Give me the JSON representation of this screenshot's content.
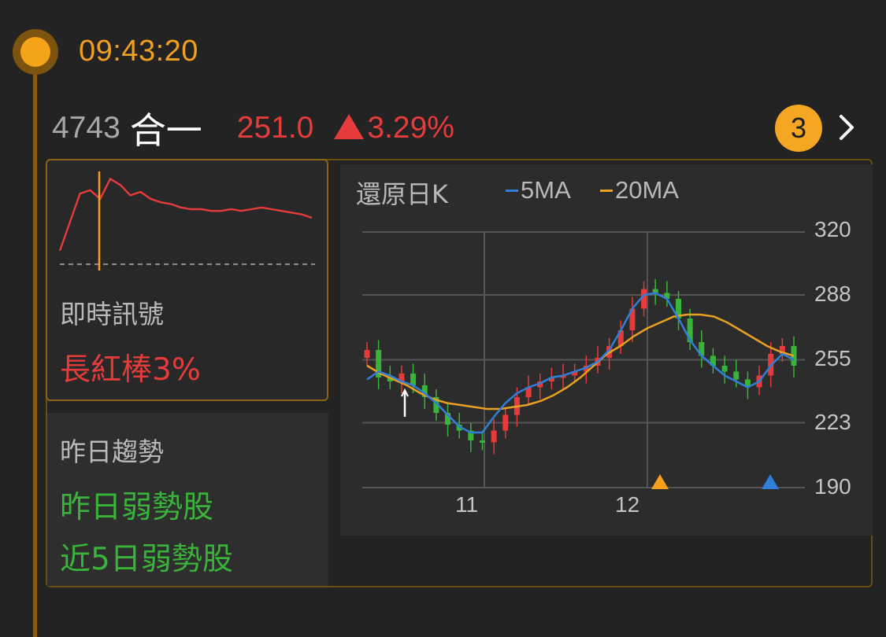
{
  "timestamp": "09:43:20",
  "stock": {
    "code": "4743",
    "name": "合一",
    "price": "251.0",
    "change": "3.29%",
    "change_direction": "up",
    "colors": {
      "up": "#e63b3b",
      "down": "#3ab33a",
      "accent": "#f5a623"
    }
  },
  "badge_count": "3",
  "signal": {
    "label": "即時訊號",
    "value": "長紅棒3%"
  },
  "trend": {
    "label": "昨日趨勢",
    "items": [
      "昨日弱勢股",
      "近5日弱勢股"
    ]
  },
  "kchart": {
    "title": "還原日K",
    "legend": [
      {
        "name": "5MA",
        "color": "#2f7fd8"
      },
      {
        "name": "20MA",
        "color": "#e8a020"
      }
    ],
    "y_ticks": [
      "320",
      "288",
      "255",
      "223",
      "190"
    ],
    "x_ticks": [
      "11",
      "12"
    ]
  },
  "chart_data": [
    {
      "type": "line",
      "title": "",
      "description_of_series": "intraday price",
      "series": [
        {
          "values": [
            0.12,
            0.45,
            0.78,
            0.82,
            0.72,
            0.95,
            0.88,
            0.76,
            0.8,
            0.72,
            0.68,
            0.66,
            0.62,
            0.6,
            0.6,
            0.58,
            0.58,
            0.6,
            0.58,
            0.6,
            0.62,
            0.6,
            0.58,
            0.56,
            0.54,
            0.5
          ]
        }
      ],
      "baseline": "dashed previous close",
      "marker_index": 5
    },
    {
      "type": "candlestick",
      "title": "還原日K",
      "y_range": [
        190,
        320
      ],
      "x_ticks": [
        "11",
        "12"
      ],
      "series": [
        {
          "name": "5MA",
          "values": [
            245,
            249,
            247,
            244,
            242,
            238,
            233,
            227,
            221,
            218,
            218,
            226,
            233,
            238,
            241,
            243,
            246,
            247,
            249,
            251,
            254,
            260,
            270,
            281,
            288,
            289,
            286,
            276,
            265,
            257,
            252,
            247,
            244,
            241,
            244,
            252,
            258,
            255
          ]
        },
        {
          "name": "20MA",
          "values": [
            252,
            248,
            245,
            242,
            238,
            235,
            233,
            232,
            231,
            230,
            230,
            231,
            232,
            234,
            237,
            241,
            246,
            252,
            258,
            262,
            267,
            271,
            274,
            277,
            278,
            278,
            277,
            274,
            270,
            266,
            262,
            259,
            257
          ]
        }
      ],
      "candles_close": [
        260,
        246,
        244,
        248,
        242,
        236,
        228,
        222,
        219,
        214,
        213,
        219,
        227,
        236,
        241,
        244,
        246,
        247,
        249,
        252,
        256,
        262,
        270,
        281,
        291,
        289,
        286,
        276,
        264,
        257,
        252,
        249,
        245,
        241,
        247,
        258,
        262,
        252
      ],
      "markers": [
        {
          "label": "up-triangle",
          "color": "#f5a019"
        },
        {
          "label": "up-triangle",
          "color": "#2f7fd8"
        }
      ]
    }
  ]
}
